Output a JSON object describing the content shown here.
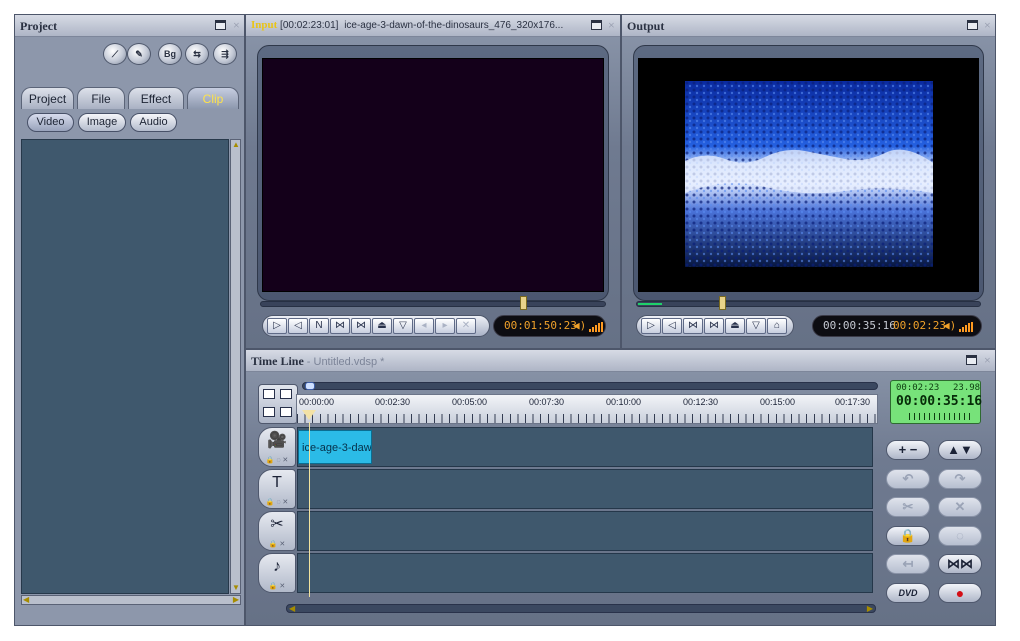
{
  "project": {
    "title": "Project",
    "toolbar_icons": [
      "new-project-icon",
      "open-project-icon",
      "bg-icon",
      "capture-icon",
      "export-icon"
    ],
    "bg_label": "Bg",
    "tabs": [
      {
        "label": "Project",
        "active": false
      },
      {
        "label": "File",
        "active": false
      },
      {
        "label": "Effect",
        "active": false
      },
      {
        "label": "Clip",
        "active": true
      }
    ],
    "filters": [
      {
        "label": "Video",
        "active": true
      },
      {
        "label": "Image",
        "active": false
      },
      {
        "label": "Audio",
        "active": false
      }
    ]
  },
  "input": {
    "title": "Input",
    "timecode": "[00:02:23:01]",
    "filename": "ice-age-3-dawn-of-the-dinosaurs_476_320x176...",
    "seek_position": 0.75,
    "controls": [
      "play-icon",
      "reverse-play-icon",
      "N",
      "next-frame-icon",
      "prev-frame-icon",
      "eject-icon",
      "mark-icon"
    ],
    "time_display": "00:01:50:23"
  },
  "output": {
    "title": "Output",
    "seek_position": 0.24,
    "progress": 0.07,
    "controls": [
      "play-icon",
      "reverse-play-icon",
      "next-frame-icon",
      "prev-frame-icon",
      "up-icon",
      "down-icon",
      "snapshot-icon"
    ],
    "time_current": "00:00:35:16",
    "time_total": "00:02:23"
  },
  "timeline": {
    "title": "Time Line",
    "subtitle": "- Untitled.vdsp *",
    "ruler_labels": [
      "00:00:00",
      "00:02:30",
      "00:05:00",
      "00:07:30",
      "00:10:00",
      "00:12:30",
      "00:15:00",
      "00:17:30"
    ],
    "clip_label": "ice-age-3-daw",
    "tracks": [
      "video-track-icon",
      "text-track-icon",
      "effect-track-icon",
      "audio-track-icon"
    ],
    "display": {
      "duration": "00:02:23",
      "fps": "23.98",
      "current": "00:00:35:16"
    },
    "dvd_label": "DVD",
    "record_symbol": "●"
  },
  "colors": {
    "panel": "#6f7a90",
    "track": "#3f586d",
    "clip": "#2bbbe7",
    "timecode_amber": "#f0a12a",
    "lcd_green": "#77e27a"
  }
}
